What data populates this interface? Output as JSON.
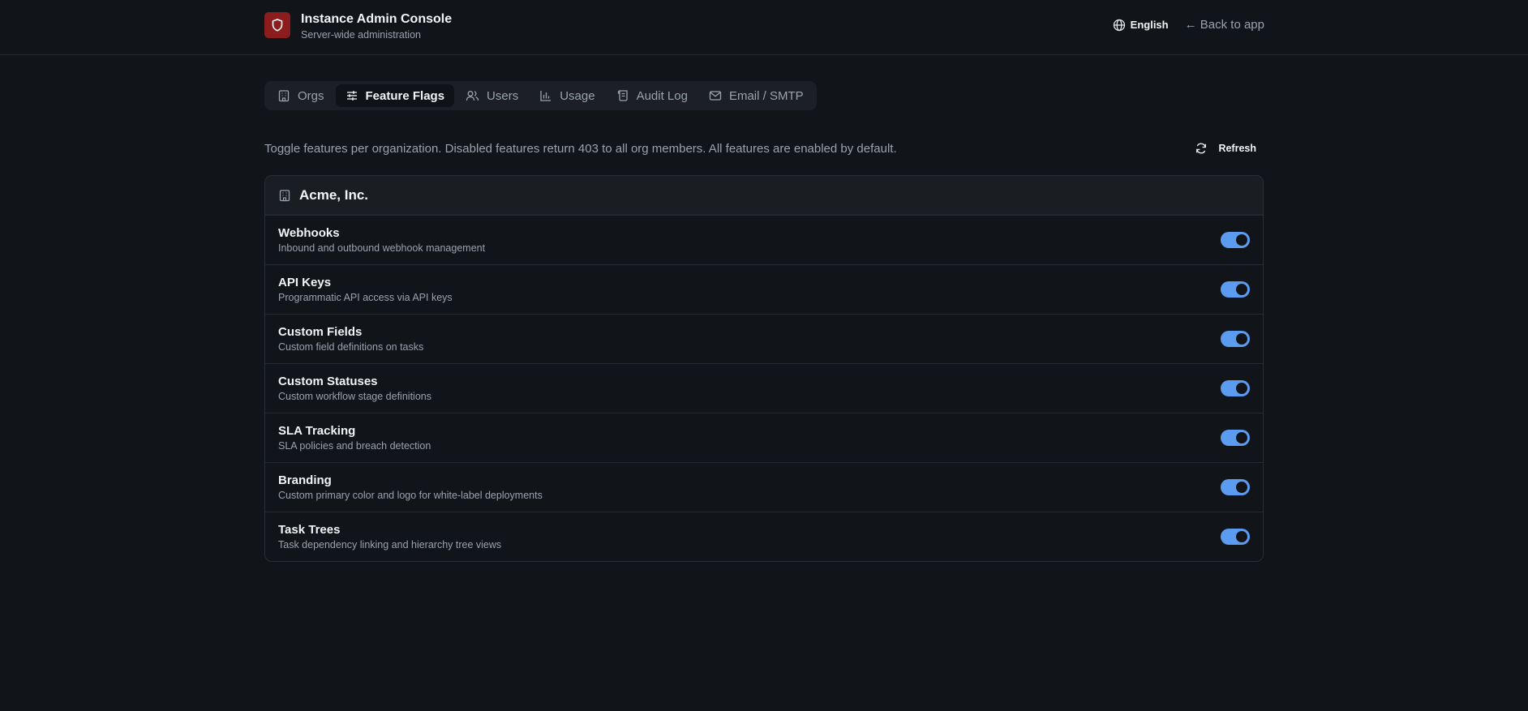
{
  "header": {
    "title": "Instance Admin Console",
    "subtitle": "Server-wide administration",
    "language": "English",
    "back_label": "← Back to app"
  },
  "tabs": [
    {
      "label": "Orgs",
      "icon": "building-icon",
      "active": false
    },
    {
      "label": "Feature Flags",
      "icon": "sliders-icon",
      "active": true
    },
    {
      "label": "Users",
      "icon": "users-icon",
      "active": false
    },
    {
      "label": "Usage",
      "icon": "bar-chart-icon",
      "active": false
    },
    {
      "label": "Audit Log",
      "icon": "scroll-icon",
      "active": false
    },
    {
      "label": "Email / SMTP",
      "icon": "mail-icon",
      "active": false
    }
  ],
  "description": "Toggle features per organization. Disabled features return 403 to all org members. All features are enabled by default.",
  "refresh_label": "Refresh",
  "org": {
    "name": "Acme, Inc.",
    "features": [
      {
        "name": "Webhooks",
        "desc": "Inbound and outbound webhook management",
        "enabled": true
      },
      {
        "name": "API Keys",
        "desc": "Programmatic API access via API keys",
        "enabled": true
      },
      {
        "name": "Custom Fields",
        "desc": "Custom field definitions on tasks",
        "enabled": true
      },
      {
        "name": "Custom Statuses",
        "desc": "Custom workflow stage definitions",
        "enabled": true
      },
      {
        "name": "SLA Tracking",
        "desc": "SLA policies and breach detection",
        "enabled": true
      },
      {
        "name": "Branding",
        "desc": "Custom primary color and logo for white-label deployments",
        "enabled": true
      },
      {
        "name": "Task Trees",
        "desc": "Task dependency linking and hierarchy tree views",
        "enabled": true
      }
    ]
  },
  "colors": {
    "background": "#111418",
    "accent": "#5b9cf0",
    "brand": "#8b1d1f"
  }
}
